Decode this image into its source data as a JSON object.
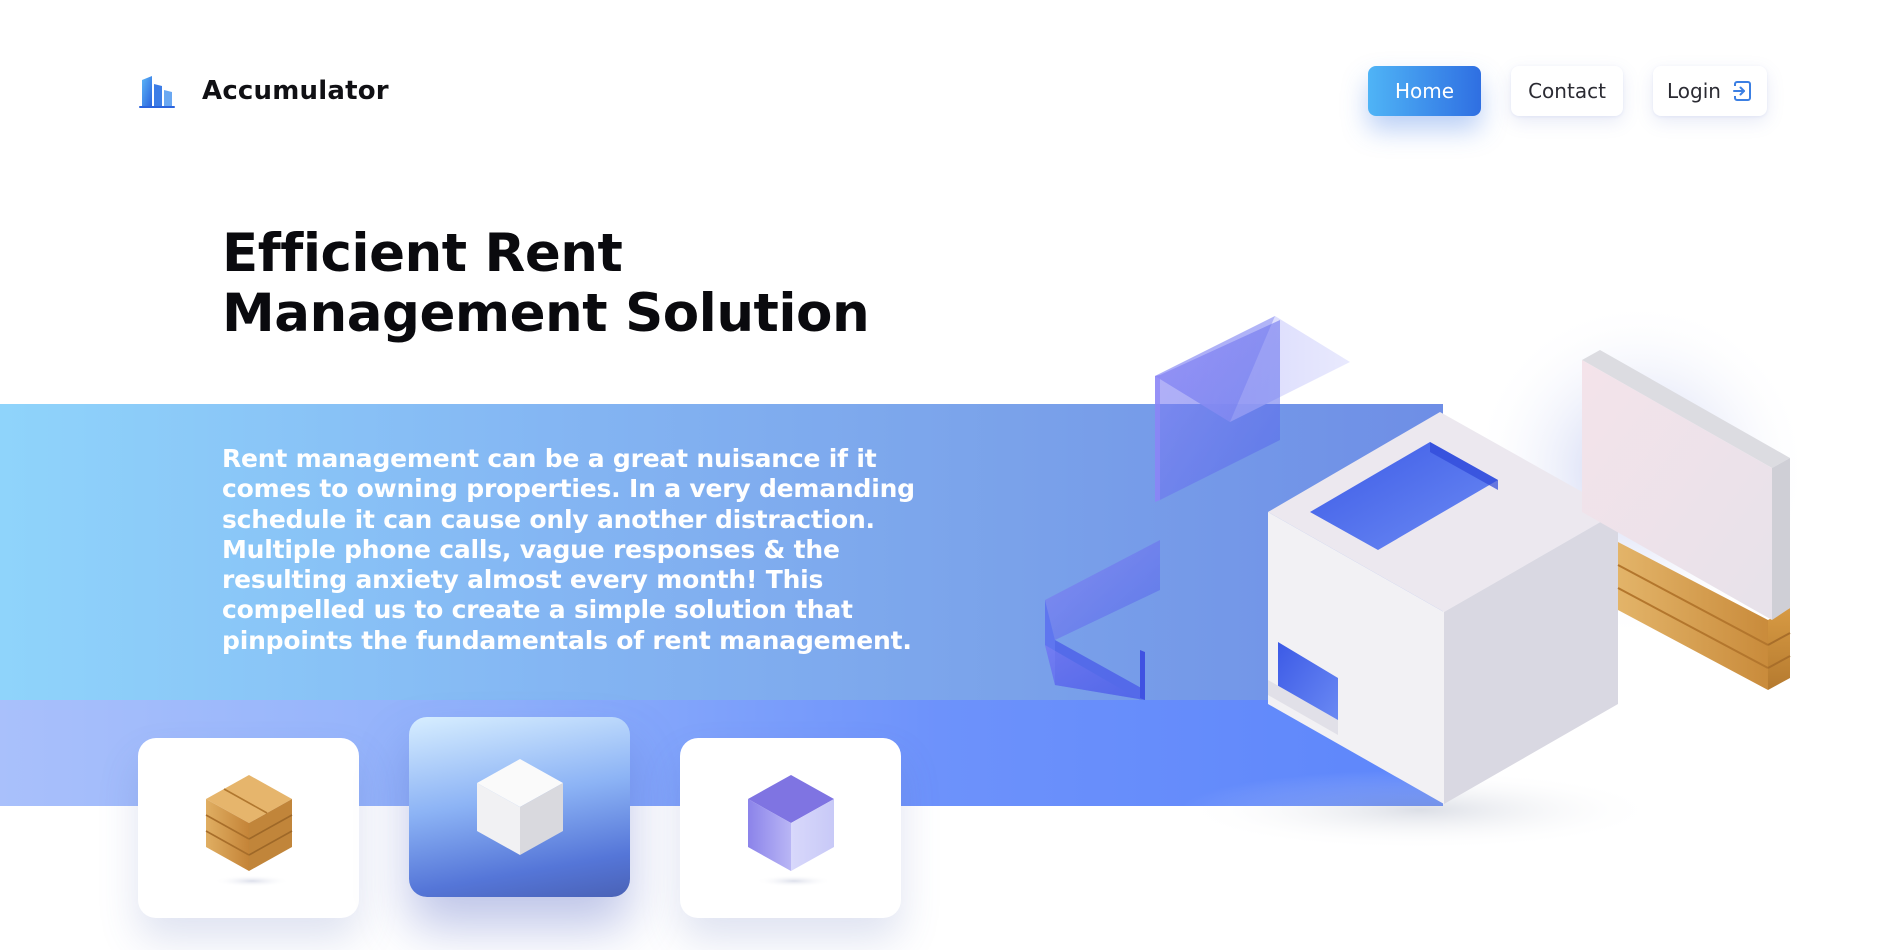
{
  "brand": {
    "name": "Accumulator",
    "logo_icon": "building-icon"
  },
  "nav": {
    "home": "Home",
    "contact": "Contact",
    "login": "Login",
    "login_icon": "login-arrow-icon"
  },
  "hero": {
    "title_line1": "Efficient Rent",
    "title_line2": "Management Solution",
    "description": "Rent management can be a great nuisance if it comes to owning properties. In a very demanding schedule it can cause only another distraction. Multiple phone calls, vague responses & the resulting anxiety almost every month! This compelled us to create a simple solution that pinpoints the fundamentals of rent management."
  },
  "cards": [
    {
      "icon": "wooden-cube-icon"
    },
    {
      "icon": "white-cube-icon",
      "active": true
    },
    {
      "icon": "glass-cube-icon"
    }
  ],
  "colors": {
    "accent": "#2f6fe2",
    "accent_light": "#4fb4f6",
    "band": "#84b6f3",
    "text": "#0a0a0e"
  }
}
